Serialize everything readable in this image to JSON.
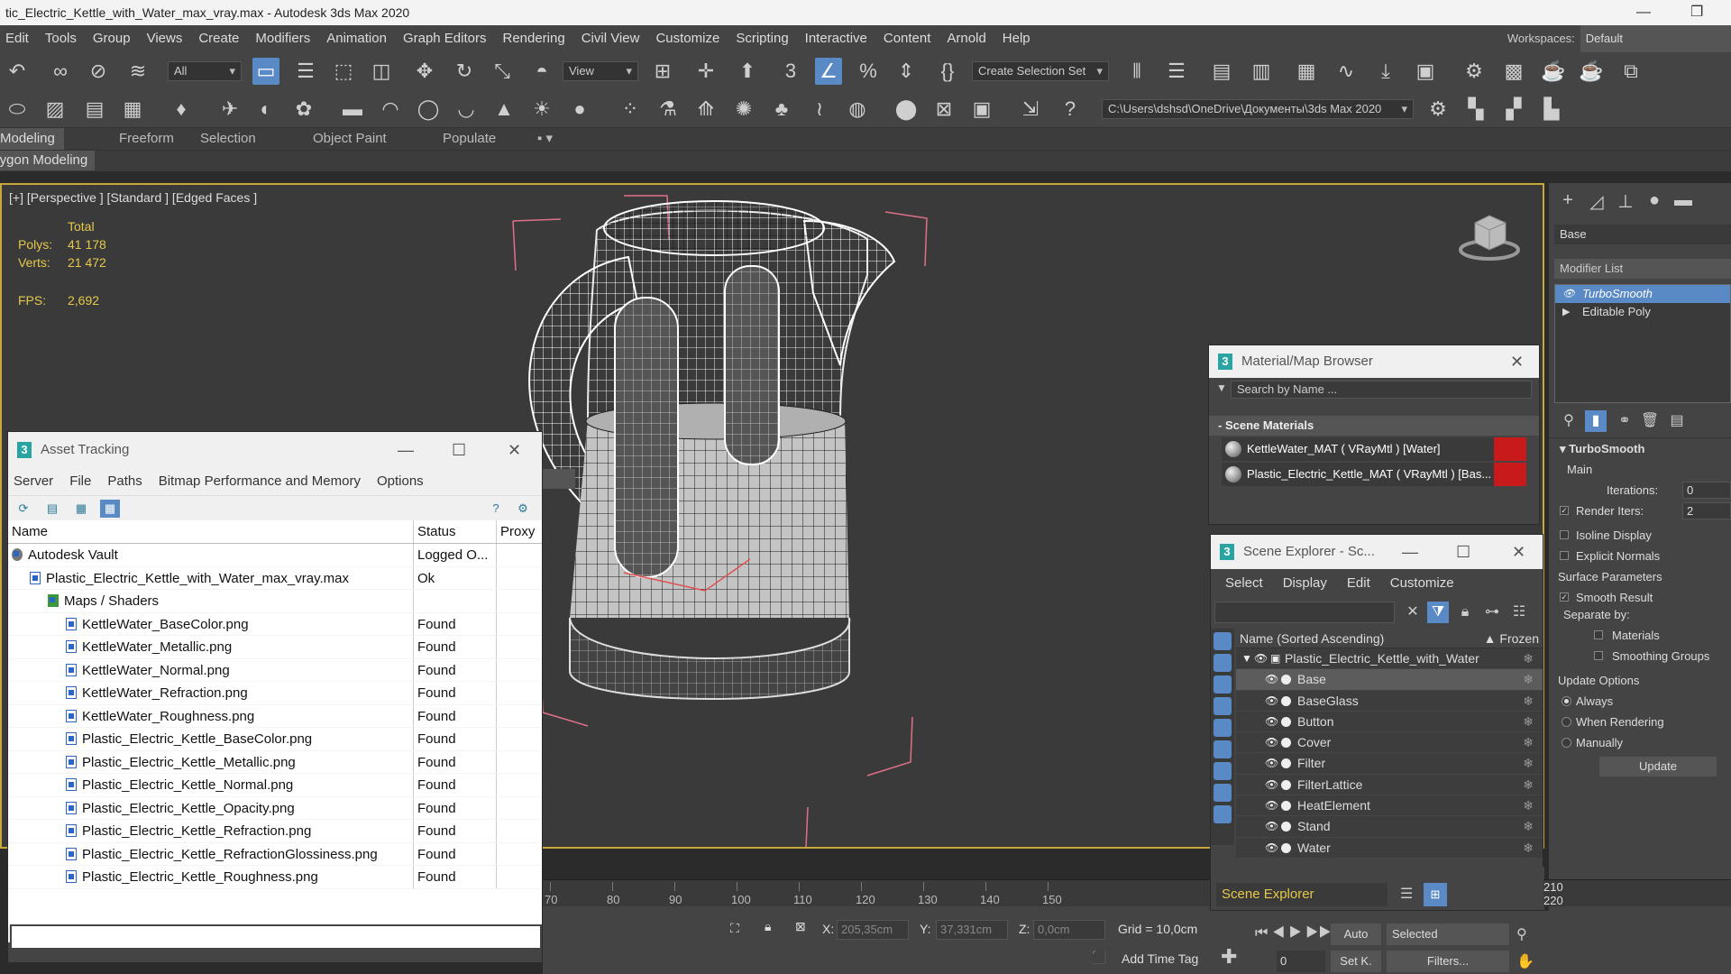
{
  "window": {
    "title": "tic_Electric_Kettle_with_Water_max_vray.max - Autodesk 3ds Max 2020",
    "minimize": "—",
    "restore": "❐"
  },
  "menu": [
    "Edit",
    "Tools",
    "Group",
    "Views",
    "Create",
    "Modifiers",
    "Animation",
    "Graph Editors",
    "Rendering",
    "Civil View",
    "Customize",
    "Scripting",
    "Interactive",
    "Content",
    "Arnold",
    "Help"
  ],
  "workspace": {
    "label": "Workspaces:",
    "value": "Default"
  },
  "toolbar": {
    "filter_dropdown": "All",
    "view_dropdown": "View",
    "selection_set": "Create Selection Set",
    "project_path": "C:\\Users\\dshsd\\OneDrive\\Документы\\3ds Max 2020"
  },
  "ribbon": {
    "tabs": [
      "Modeling",
      "Freeform",
      "Selection",
      "Object Paint",
      "Populate"
    ],
    "active_tab": "Modeling",
    "sub_label": "Polygon Modeling"
  },
  "viewport": {
    "label": "[+] [Perspective ] [Standard ] [Edged Faces ]",
    "stats_header": "Total",
    "polys_label": "Polys:",
    "polys_value": "41 178",
    "verts_label": "Verts:",
    "verts_value": "21 472",
    "fps_label": "FPS:",
    "fps_value": "2,692"
  },
  "asset_tracking": {
    "title": "Asset Tracking",
    "menu": [
      "Server",
      "File",
      "Paths",
      "Bitmap Performance and Memory",
      "Options"
    ],
    "columns": [
      "Name",
      "Status",
      "Proxy"
    ],
    "rows": [
      {
        "name": "Autodesk Vault",
        "status": "Logged O...",
        "indent": 0,
        "icon": "vault-icon"
      },
      {
        "name": "Plastic_Electric_Kettle_with_Water_max_vray.max",
        "status": "Ok",
        "indent": 1,
        "icon": "max-file-icon"
      },
      {
        "name": "Maps / Shaders",
        "status": "",
        "indent": 2,
        "icon": "maps-icon"
      },
      {
        "name": "KettleWater_BaseColor.png",
        "status": "Found",
        "indent": 3,
        "icon": "image-file-icon"
      },
      {
        "name": "KettleWater_Metallic.png",
        "status": "Found",
        "indent": 3,
        "icon": "image-file-icon"
      },
      {
        "name": "KettleWater_Normal.png",
        "status": "Found",
        "indent": 3,
        "icon": "image-file-icon"
      },
      {
        "name": "KettleWater_Refraction.png",
        "status": "Found",
        "indent": 3,
        "icon": "image-file-icon"
      },
      {
        "name": "KettleWater_Roughness.png",
        "status": "Found",
        "indent": 3,
        "icon": "image-file-icon"
      },
      {
        "name": "Plastic_Electric_Kettle_BaseColor.png",
        "status": "Found",
        "indent": 3,
        "icon": "image-file-icon"
      },
      {
        "name": "Plastic_Electric_Kettle_Metallic.png",
        "status": "Found",
        "indent": 3,
        "icon": "image-file-icon"
      },
      {
        "name": "Plastic_Electric_Kettle_Normal.png",
        "status": "Found",
        "indent": 3,
        "icon": "image-file-icon"
      },
      {
        "name": "Plastic_Electric_Kettle_Opacity.png",
        "status": "Found",
        "indent": 3,
        "icon": "image-file-icon"
      },
      {
        "name": "Plastic_Electric_Kettle_Refraction.png",
        "status": "Found",
        "indent": 3,
        "icon": "image-file-icon"
      },
      {
        "name": "Plastic_Electric_Kettle_RefractionGlossiness.png",
        "status": "Found",
        "indent": 3,
        "icon": "image-file-icon"
      },
      {
        "name": "Plastic_Electric_Kettle_Roughness.png",
        "status": "Found",
        "indent": 3,
        "icon": "image-file-icon"
      }
    ]
  },
  "material_browser": {
    "title": "Material/Map Browser",
    "search_placeholder": "Search by Name ...",
    "section": "- Scene Materials",
    "materials": [
      "KettleWater_MAT  ( VRayMtl )  [Water]",
      "Plastic_Electric_Kettle_MAT  ( VRayMtl )  [Bas..."
    ]
  },
  "scene_explorer": {
    "title": "Scene Explorer - Sc...",
    "menu": [
      "Select",
      "Display",
      "Edit",
      "Customize"
    ],
    "col_name": "Name (Sorted Ascending)",
    "col_frozen": "▲ Frozen",
    "root": "Plastic_Electric_Kettle_with_Water",
    "objects": [
      "Base",
      "BaseGlass",
      "Button",
      "Cover",
      "Filter",
      "FilterLattice",
      "HeatElement",
      "Stand",
      "Water"
    ],
    "selected": "Base",
    "bottom_dropdown": "Scene Explorer"
  },
  "command_panel": {
    "object_name": "Base",
    "modifier_list": "Modifier List",
    "stack": [
      "TurboSmooth",
      "Editable Poly"
    ],
    "turbosmooth": {
      "header": "TurboSmooth",
      "main": "Main",
      "iterations_label": "Iterations:",
      "iterations_value": "0",
      "render_iters_label": "Render Iters:",
      "render_iters_value": "2",
      "isoline": "Isoline Display",
      "explicit_normals": "Explicit Normals",
      "surface_params": "Surface Parameters",
      "smooth_result": "Smooth Result",
      "separate_by": "Separate by:",
      "materials": "Materials",
      "smoothing_groups": "Smoothing Groups",
      "update_options": "Update Options",
      "always": "Always",
      "when_rendering": "When Rendering",
      "manually": "Manually",
      "update_button": "Update"
    }
  },
  "timeline": {
    "ticks": [
      "70",
      "80",
      "90",
      "100",
      "110",
      "120",
      "130",
      "140",
      "150"
    ],
    "ticks_right": [
      "210",
      "220"
    ]
  },
  "status_bar": {
    "x_label": "X:",
    "x_value": "205,35cm",
    "y_label": "Y:",
    "y_value": "37,331cm",
    "z_label": "Z:",
    "z_value": "0,0cm",
    "grid": "Grid = 10,0cm",
    "add_time_tag": "Add Time Tag"
  },
  "anim_controls": {
    "auto": "Auto",
    "selected": "Selected",
    "frame": "0",
    "set_key": "Set K.",
    "filters": "Filters..."
  }
}
